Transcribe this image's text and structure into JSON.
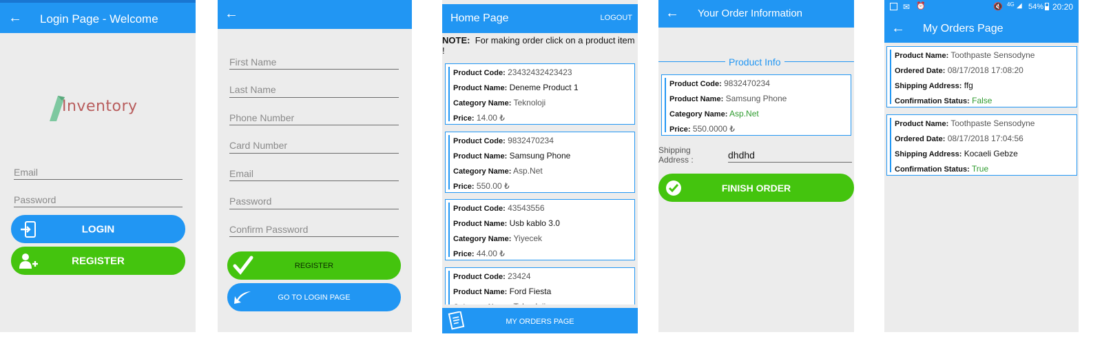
{
  "login": {
    "title": "Login Page - Welcome",
    "logo_text": "Inventory",
    "email_placeholder": "Email",
    "password_placeholder": "Password",
    "login_label": "LOGIN",
    "register_label": "REGISTER"
  },
  "register": {
    "fields": [
      "First Name",
      "Last Name",
      "Phone Number",
      "Card Number",
      "Email",
      "Password",
      "Confirm Password"
    ],
    "register_label": "REGISTER",
    "goto_login_label": "GO TO LOGIN PAGE"
  },
  "home": {
    "title": "Home Page",
    "logout_label": "LOGOUT",
    "note_bold": "NOTE:",
    "note_text": "For making order click on a product item !",
    "labels": {
      "code": "Product Code:",
      "name": "Product Name:",
      "category": "Category Name:",
      "price": "Price:"
    },
    "products": [
      {
        "code": "23432432423423",
        "name": "Deneme Product 1",
        "category": "Teknoloji",
        "price": "14.00 ₺"
      },
      {
        "code": "9832470234",
        "name": "Samsung Phone",
        "category": "Asp.Net",
        "price": "550.00 ₺"
      },
      {
        "code": "43543556",
        "name": "Usb kablo 3.0",
        "category": "Yiyecek",
        "price": "44.00 ₺"
      },
      {
        "code": "23424",
        "name": "Ford Fiesta",
        "category": "Teknoloji",
        "price": ""
      }
    ],
    "my_orders_label": "MY ORDERS PAGE"
  },
  "order": {
    "title": "Your Order Information",
    "section_label": "Product Info",
    "labels": {
      "code": "Product Code:",
      "name": "Product Name:",
      "category": "Category Name:",
      "price": "Price:"
    },
    "product": {
      "code": "9832470234",
      "name": "Samsung Phone",
      "category": "Asp.Net",
      "price": "550.0000 ₺"
    },
    "shipping_label": "Shipping Address :",
    "shipping_value": "dhdhd",
    "finish_label": "FINISH ORDER"
  },
  "orders": {
    "status_bar": {
      "battery": "54%",
      "time": "20:20",
      "network": "4G"
    },
    "title": "My Orders Page",
    "labels": {
      "name": "Product Name:",
      "date": "Ordered Date:",
      "address": "Shipping Address:",
      "status": "Confirmation Status:"
    },
    "items": [
      {
        "name": "Toothpaste Sensodyne",
        "date": "08/17/2018 17:08:20",
        "address": "ffg",
        "status": "False"
      },
      {
        "name": "Toothpaste Sensodyne",
        "date": "08/17/2018 17:04:56",
        "address": "Kocaeli Gebze",
        "status": "True"
      }
    ]
  },
  "colors": {
    "primary": "#2196f3",
    "success": "#44c40e",
    "background": "#ececec"
  }
}
